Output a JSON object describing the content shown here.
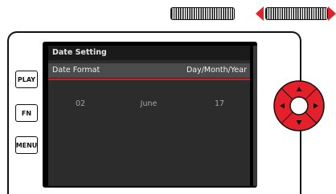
{
  "side_buttons": {
    "play": "PLAY",
    "fn": "FN",
    "menu": "MENU"
  },
  "screen": {
    "title": "Date Setting",
    "date_format_label": "Date Format",
    "date_format_value": "Day/Month/Year",
    "day": "02",
    "month": "June",
    "year": "17"
  },
  "colors": {
    "accent": "#e4202a",
    "screen_bg": "#2c2c2c",
    "selected_row": "#4b4b4b"
  }
}
